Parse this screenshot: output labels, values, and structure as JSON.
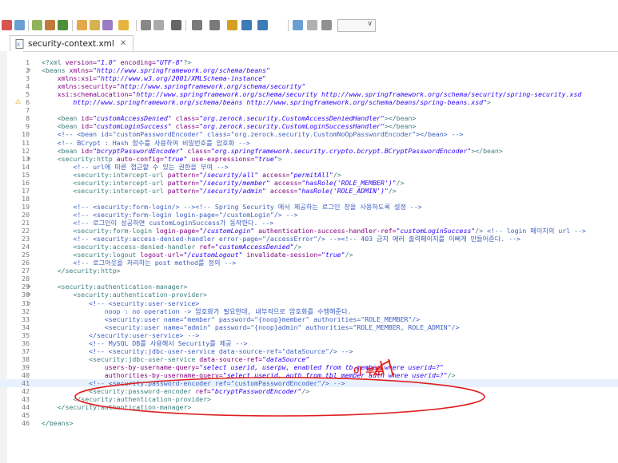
{
  "editor_tab": {
    "title": "security-context.xml",
    "close_glyph": "✕",
    "icon": "xml-file-icon"
  },
  "toolbar": {
    "icons": [
      "new-icon",
      "debug-icon",
      "git-icon",
      "run-icon",
      "search-icon",
      "open-type-icon",
      "annotation-icon",
      "next-icon",
      "back-icon",
      "forward-icon",
      "pin-icon",
      "toggle-icon"
    ]
  },
  "colors": {
    "tag": "#3f7f7f",
    "attribute": "#7f007f",
    "value": "#2a00ff",
    "comment": "#3f5fbf",
    "annotation": "#e02020",
    "active_line": "#e8f2fe"
  },
  "annotation": {
    "handwriting": "이 부분"
  },
  "lines": [
    {
      "n": "1",
      "fold": "",
      "segments": [
        [
          "tag",
          "<?xml "
        ],
        [
          "attr",
          "version="
        ],
        [
          "val",
          "\"1.0\""
        ],
        [
          "attr",
          " encoding="
        ],
        [
          "val",
          "\"UTF-8\""
        ],
        [
          "tag",
          "?>"
        ]
      ]
    },
    {
      "n": "2",
      "fold": "⊖",
      "segments": [
        [
          "tag",
          "<beans "
        ],
        [
          "attr",
          "xmlns="
        ],
        [
          "val",
          "\"http://www.springframework.org/schema/beans\""
        ]
      ]
    },
    {
      "n": "3",
      "fold": "",
      "segments": [
        [
          "plain",
          "    "
        ],
        [
          "attr",
          "xmlns:xsi="
        ],
        [
          "val",
          "\"http://www.w3.org/2001/XMLSchema-instance\""
        ]
      ]
    },
    {
      "n": "4",
      "fold": "",
      "segments": [
        [
          "plain",
          "    "
        ],
        [
          "attr",
          "xmlns:security="
        ],
        [
          "val",
          "\"http://www.springframework.org/schema/security\""
        ]
      ]
    },
    {
      "n": "5",
      "fold": "",
      "segments": [
        [
          "plain",
          "    "
        ],
        [
          "attr",
          "xsi:schemaLocation="
        ],
        [
          "val",
          "\"http://www.springframework.org/schema/security http://www.springframework.org/schema/security/spring-security.xsd"
        ]
      ]
    },
    {
      "n": "6",
      "fold": "",
      "warn": true,
      "segments": [
        [
          "val",
          "        http://www.springframework.org/schema/beans http://www.springframework.org/schema/beans/spring-beans.xsd\""
        ],
        [
          "tag",
          ">"
        ]
      ]
    },
    {
      "n": "7",
      "fold": "",
      "segments": []
    },
    {
      "n": "8",
      "fold": "",
      "segments": [
        [
          "plain",
          "    "
        ],
        [
          "tag",
          "<bean "
        ],
        [
          "attr",
          "id="
        ],
        [
          "val",
          "\"customAccessDenied\""
        ],
        [
          "attr",
          " class="
        ],
        [
          "val",
          "\"org.zerock.security.CustomAccessDeniedHandler\""
        ],
        [
          "tag",
          "></bean>"
        ]
      ]
    },
    {
      "n": "9",
      "fold": "",
      "segments": [
        [
          "plain",
          "    "
        ],
        [
          "tag",
          "<bean "
        ],
        [
          "attr",
          "id="
        ],
        [
          "val",
          "\"customLoginSuccess\""
        ],
        [
          "attr",
          " class="
        ],
        [
          "val",
          "\"org.zerock.security.CustomLoginSuccessHandler\""
        ],
        [
          "tag",
          "></bean>"
        ]
      ]
    },
    {
      "n": "10",
      "fold": "",
      "segments": [
        [
          "com",
          "    <!-- <bean id=\"customPasswordEncoder\" class=\"org.zerock.security.CustomNoOpPasswordEncoder\"></bean> -->"
        ]
      ]
    },
    {
      "n": "11",
      "fold": "",
      "segments": [
        [
          "com",
          "    <!-- BCrypt : Hash 함수를 사용하여 비밀번호를 암호화 -->"
        ]
      ]
    },
    {
      "n": "12",
      "fold": "",
      "segments": [
        [
          "plain",
          "    "
        ],
        [
          "tag",
          "<bean "
        ],
        [
          "attr",
          "id="
        ],
        [
          "val",
          "\"bcryptPasswordEncoder\""
        ],
        [
          "attr",
          " class="
        ],
        [
          "val",
          "\"org.springframework.security.crypto.bcrypt.BCryptPasswordEncoder\""
        ],
        [
          "tag",
          "></bean>"
        ]
      ]
    },
    {
      "n": "13",
      "fold": "⊖",
      "segments": [
        [
          "plain",
          "    "
        ],
        [
          "tag",
          "<security:http "
        ],
        [
          "attr",
          "auto-config="
        ],
        [
          "val",
          "\"true\""
        ],
        [
          "attr",
          " use-expressions="
        ],
        [
          "val",
          "\"true\""
        ],
        [
          "tag",
          ">"
        ]
      ]
    },
    {
      "n": "14",
      "fold": "",
      "segments": [
        [
          "com",
          "        <!-- url에 따른 접근할 수 있는 권한을 부여 -->"
        ]
      ]
    },
    {
      "n": "15",
      "fold": "",
      "segments": [
        [
          "plain",
          "        "
        ],
        [
          "tag",
          "<security:intercept-url "
        ],
        [
          "attr",
          "pattern="
        ],
        [
          "val",
          "\"/security/all\""
        ],
        [
          "attr",
          " access="
        ],
        [
          "val",
          "\"permitAll\""
        ],
        [
          "tag",
          "/>"
        ]
      ]
    },
    {
      "n": "16",
      "fold": "",
      "segments": [
        [
          "plain",
          "        "
        ],
        [
          "tag",
          "<security:intercept-url "
        ],
        [
          "attr",
          "pattern="
        ],
        [
          "val",
          "\"/security/member\""
        ],
        [
          "attr",
          " access="
        ],
        [
          "val",
          "\"hasRole('ROLE_MEMBER')\""
        ],
        [
          "tag",
          "/>"
        ]
      ]
    },
    {
      "n": "17",
      "fold": "",
      "segments": [
        [
          "plain",
          "        "
        ],
        [
          "tag",
          "<security:intercept-url "
        ],
        [
          "attr",
          "pattern="
        ],
        [
          "val",
          "\"/security/admin\""
        ],
        [
          "attr",
          " access="
        ],
        [
          "val",
          "\"hasRole('ROLE_ADMIN')\""
        ],
        [
          "tag",
          "/>"
        ]
      ]
    },
    {
      "n": "18",
      "fold": "",
      "segments": []
    },
    {
      "n": "19",
      "fold": "",
      "segments": [
        [
          "com",
          "        <!-- <security:form-login/> --><!-- Spring Security 에서 제공하는 로그인 창을 사용하도록 설정 -->"
        ]
      ]
    },
    {
      "n": "20",
      "fold": "",
      "segments": [
        [
          "com",
          "        <!-- <security:form-login login-page=\"/customLogin\"/> -->"
        ]
      ]
    },
    {
      "n": "21",
      "fold": "",
      "segments": [
        [
          "com",
          "        <!-- 로그인이 성공하면 customLoginSuccess가 동작한다. -->"
        ]
      ]
    },
    {
      "n": "22",
      "fold": "",
      "segments": [
        [
          "plain",
          "        "
        ],
        [
          "tag",
          "<security:form-login "
        ],
        [
          "attr",
          "login-page="
        ],
        [
          "val",
          "\"/customLogin\""
        ],
        [
          "attr",
          " authentication-success-handler-ref="
        ],
        [
          "val",
          "\"customLoginSuccess\""
        ],
        [
          "tag",
          "/> "
        ],
        [
          "com",
          "<!-- login 페이지의 url -->"
        ]
      ]
    },
    {
      "n": "23",
      "fold": "",
      "segments": [
        [
          "com",
          "        <!-- <security:access-denied-handler error-page=\"/accessError\"/> --><!-- 403 금지 에러 출력페이지를 이뻐게 만들어준다. -->"
        ]
      ]
    },
    {
      "n": "24",
      "fold": "",
      "segments": [
        [
          "plain",
          "        "
        ],
        [
          "tag",
          "<security:access-denied-handler "
        ],
        [
          "attr",
          "ref="
        ],
        [
          "val",
          "\"customAccessDenied\""
        ],
        [
          "tag",
          "/>"
        ]
      ]
    },
    {
      "n": "25",
      "fold": "",
      "segments": [
        [
          "plain",
          "        "
        ],
        [
          "tag",
          "<security:logout "
        ],
        [
          "attr",
          "logout-url="
        ],
        [
          "val",
          "\"/customLogout\""
        ],
        [
          "attr",
          " invalidate-session="
        ],
        [
          "val",
          "\"true\""
        ],
        [
          "tag",
          "/>"
        ]
      ]
    },
    {
      "n": "26",
      "fold": "",
      "segments": [
        [
          "com",
          "        <!-- 로그아웃을 처리하는 post method를 정의 -->"
        ]
      ]
    },
    {
      "n": "27",
      "fold": "",
      "segments": [
        [
          "plain",
          "    "
        ],
        [
          "tag",
          "</security:http>"
        ]
      ]
    },
    {
      "n": "28",
      "fold": "",
      "segments": []
    },
    {
      "n": "29",
      "fold": "⊖",
      "segments": [
        [
          "plain",
          "    "
        ],
        [
          "tag",
          "<security:authentication-manager>"
        ]
      ]
    },
    {
      "n": "30",
      "fold": "⊖",
      "segments": [
        [
          "plain",
          "        "
        ],
        [
          "tag",
          "<security:authentication-provider>"
        ]
      ]
    },
    {
      "n": "31",
      "fold": "⊖",
      "segments": [
        [
          "com",
          "            <!-- <security:user-service>"
        ]
      ]
    },
    {
      "n": "32",
      "fold": "",
      "segments": [
        [
          "com",
          "                noop : no operation -> 암호화가 필요한데, 내부적으로 암호화를 수행해준다."
        ]
      ]
    },
    {
      "n": "33",
      "fold": "",
      "segments": [
        [
          "com",
          "                <security:user name=\"member\" password=\"{noop}member\" authorities=\"ROLE_MEMBER\"/>"
        ]
      ]
    },
    {
      "n": "34",
      "fold": "",
      "segments": [
        [
          "com",
          "                <security:user name=\"admin\" password=\"{noop}admin\" authorities=\"ROLE_MEMBER, ROLE_ADMIN\"/>"
        ]
      ]
    },
    {
      "n": "35",
      "fold": "",
      "segments": [
        [
          "com",
          "            </security:user-service> -->"
        ]
      ]
    },
    {
      "n": "36",
      "fold": "",
      "segments": [
        [
          "com",
          "            <!-- MySQL DB를 사용해서 Security를 제공 -->"
        ]
      ]
    },
    {
      "n": "37",
      "fold": "",
      "segments": [
        [
          "com",
          "            <!-- <security:jdbc-user-service data-source-ref=\"dataSource\"/> -->"
        ]
      ]
    },
    {
      "n": "38",
      "fold": "",
      "segments": [
        [
          "plain",
          "            "
        ],
        [
          "tag",
          "<security:jdbc-user-service "
        ],
        [
          "attr",
          "data-source-ref="
        ],
        [
          "val",
          "\"dataSource\""
        ]
      ]
    },
    {
      "n": "39",
      "fold": "",
      "segments": [
        [
          "plain",
          "                "
        ],
        [
          "attr",
          "users-by-username-query="
        ],
        [
          "val",
          "\"select userid, userpw, enabled from tb_member where userid=?\""
        ]
      ]
    },
    {
      "n": "40",
      "fold": "",
      "segments": [
        [
          "plain",
          "                "
        ],
        [
          "attr",
          "authorities-by-username-query="
        ],
        [
          "val",
          "\"select userid, auth from tbl_member_auth where userid=?\""
        ],
        [
          "tag",
          "/>"
        ]
      ]
    },
    {
      "n": "41",
      "fold": "",
      "active": true,
      "segments": [
        [
          "com",
          "            <!-- <security:password-encoder ref=\"customPasswordEncoder\"/> -->"
        ]
      ]
    },
    {
      "n": "42",
      "fold": "",
      "segments": [
        [
          "plain",
          "            "
        ],
        [
          "tag",
          "<security:password-encoder "
        ],
        [
          "attr",
          "ref="
        ],
        [
          "val",
          "\"bcryptPasswordEncoder\""
        ],
        [
          "tag",
          "/>"
        ]
      ]
    },
    {
      "n": "43",
      "fold": "",
      "segments": [
        [
          "plain",
          "        "
        ],
        [
          "tag",
          "</security:authentication-provider>"
        ]
      ]
    },
    {
      "n": "44",
      "fold": "",
      "segments": [
        [
          "plain",
          "    "
        ],
        [
          "tag",
          "</security:authentication-manager>"
        ]
      ]
    },
    {
      "n": "45",
      "fold": "",
      "segments": []
    },
    {
      "n": "46",
      "fold": "",
      "segments": [
        [
          "tag",
          "</beans>"
        ]
      ]
    }
  ]
}
